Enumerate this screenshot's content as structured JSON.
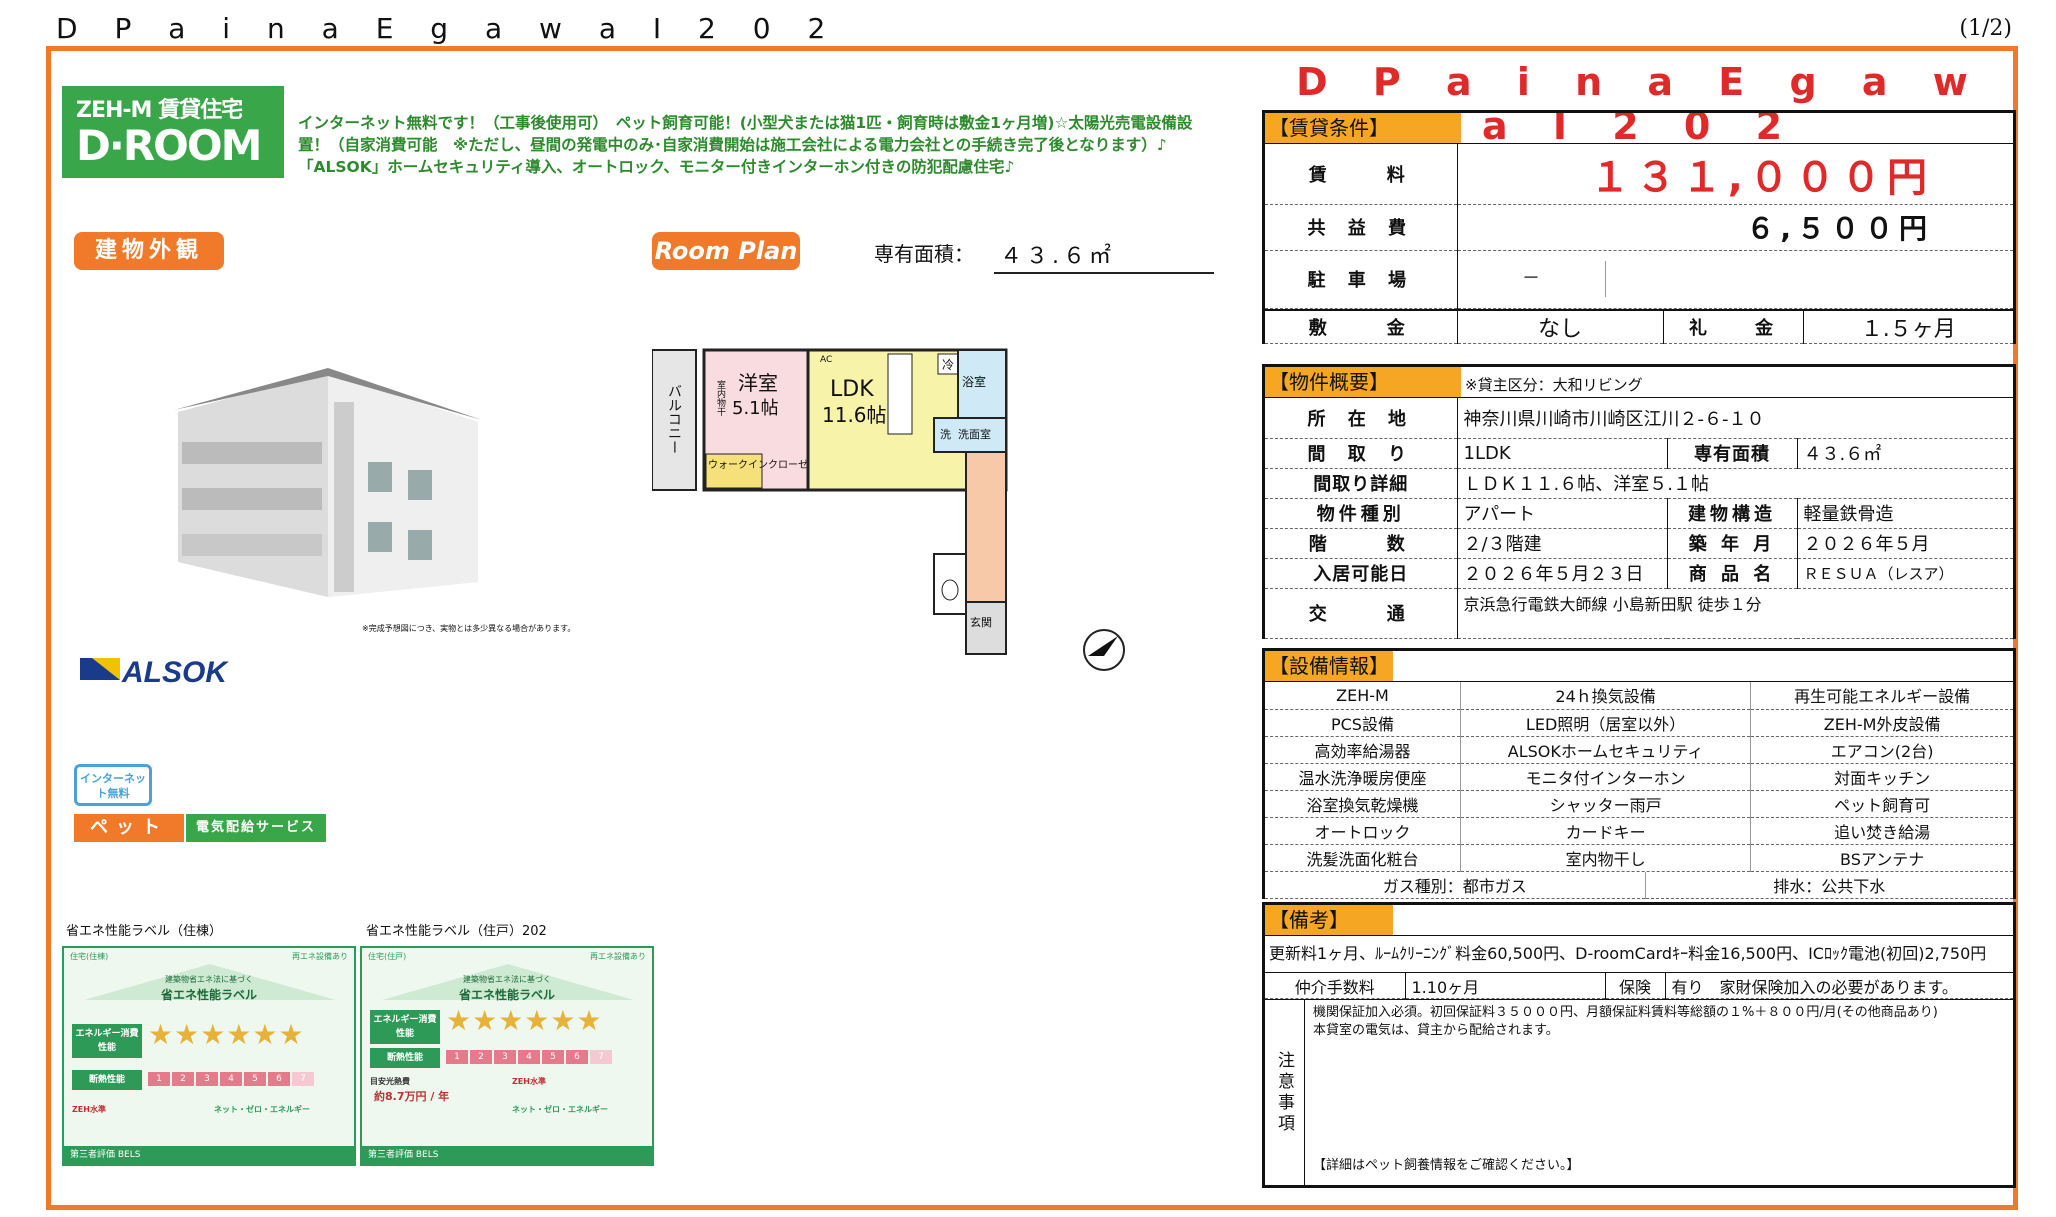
{
  "header": {
    "title": "D P a i n a  E g a w a  Ⅰ 2 0 2",
    "page": "(1/2)"
  },
  "logo": {
    "line1": "ZEH-M 賃貸住宅",
    "line2": "D·ROOM"
  },
  "intro": {
    "line1": "インターネット無料です！（工事後使用可）　ペット飼育可能！(小型犬または猫1匹・飼育時は敷金1ヶ月増)☆太陽光売電設備設",
    "line2": "置！（自家消費可能　※ただし、昼間の発電中のみ･自家消費開始は施工会社による電力会社との手続き完了後となります）♪",
    "line3": "「ALSOK」ホームセキュリティ導入、オートロック、モニター付きインターホン付きの防犯配慮住宅♪"
  },
  "tags": {
    "exterior": "建物外観",
    "plan": "Room Plan"
  },
  "area": {
    "label": "専有面積：",
    "value": "４３.６㎡"
  },
  "building_note": "※完成予想図につき、実物とは多少異なる場合があります。",
  "alsok": "ALSOK",
  "badges": {
    "net": "インターネット無料",
    "pet": "ペット",
    "elec": "電気配給サービス"
  },
  "plan": {
    "balcony": "バルコニー",
    "western_room": "洋室",
    "western_size": "5.1帖",
    "ldk": "LDK",
    "ldk_size": "11.6帖",
    "closet_in": "室内物干",
    "walkin": "ウォークインクローゼット",
    "bath": "浴室",
    "wash": "洗面室",
    "fridge": "冷",
    "entrance": "玄関",
    "ac": "AC",
    "wash_mark": "洗"
  },
  "labels": {
    "building_label_title": "省エネ性能ラベル（住棟）",
    "unit_label_title": "省エネ性能ラベル（住戸）202",
    "label_header_left_1": "住宅(住棟)",
    "label_header_left_2": "住宅(住戸)",
    "label_header_right": "再エネ設備あり",
    "label_sub": "建築物省エネ法に基づく",
    "label_name": "省エネ性能ラベル",
    "energy_row": "エネルギー消費性能",
    "insulation_row": "断熱性能",
    "zeh": "ZEH水準",
    "net_zero": "ネット・ゼロ・エネルギー",
    "cost_label": "目安光熱費",
    "cost_value": "約8.7万円 / 年",
    "footer": "第三者評価 BELS",
    "scale": [
      "1",
      "2",
      "3",
      "4",
      "5",
      "6",
      "7"
    ]
  },
  "property": {
    "title": "D P a i n a  E g a w a  Ⅰ 2 0 2"
  },
  "conditions": {
    "section": "【賃貸条件】",
    "rent_label": "賃　　料",
    "rent": "１３１,０００円",
    "common_label": "共 益 費",
    "common": "６,５００円",
    "parking_label": "駐 車 場",
    "parking": "－",
    "deposit_label": "敷　　金",
    "deposit": "なし",
    "key_label": "礼　　金",
    "key_money": "１.５ヶ月"
  },
  "overview": {
    "section": "【物件概要】",
    "note": "※貸主区分：大和リビング",
    "address_label": "所 在 地",
    "address": "神奈川県川崎市川崎区江川２-６-１０",
    "layout_label": "間 取 り",
    "layout": "1LDK",
    "area_label": "専有面積",
    "area": "４３.６㎡",
    "layout_detail_label": "間取り詳細",
    "layout_detail": "ＬＤＫ１１.６帖、洋室５.１帖",
    "type_label": "物件種別",
    "type": "アパート",
    "structure_label": "建物構造",
    "structure": "軽量鉄骨造",
    "floor_label": "階　　数",
    "floor": "２/３階建",
    "built_label": "築 年 月",
    "built": "２０２６年５月",
    "move_label": "入居可能日",
    "move": "２０２６年５月２３日",
    "product_label": "商 品 名",
    "product": "ＲＥＳＵＡ（レスア）",
    "access_label": "交　　通",
    "access": "京浜急行電鉄大師線 小島新田駅 徒歩１分"
  },
  "equipment": {
    "section": "【設備情報】",
    "rows": [
      [
        "ZEH-M",
        "24ｈ換気設備",
        "再生可能エネルギー設備"
      ],
      [
        "PCS設備",
        "LED照明（居室以外）",
        "ZEH-M外皮設備"
      ],
      [
        "高効率給湯器",
        "ALSOKホームセキュリティ",
        "エアコン(2台)"
      ],
      [
        "温水洗浄暖房便座",
        "モニタ付インターホン",
        "対面キッチン"
      ],
      [
        "浴室換気乾燥機",
        "シャッター雨戸",
        "ペット飼育可"
      ],
      [
        "オートロック",
        "カードキー",
        "追い焚き給湯"
      ],
      [
        "洗髪洗面化粧台",
        "室内物干し",
        "BSアンテナ"
      ]
    ],
    "gas": "ガス種別：都市ガス",
    "drain": "排水：公共下水"
  },
  "remarks": {
    "section": "【備考】",
    "text": "更新料1ヶ月、ﾙｰﾑｸﾘｰﾆﾝｸﾞ料金60,500円、D-roomCardｷｰ料金16,500円、ICﾛｯｸ電池(初回)2,750円",
    "brokerage_label": "仲介手数料",
    "brokerage": "1.10ヶ月",
    "insurance_label": "保険",
    "insurance": "有り　家財保険加入の必要があります。",
    "caution_label": "注意事項",
    "caution1": "機関保証加入必須。初回保証料３５０００円、月額保証料賃料等総額の１%＋８００円/月(その他商品あり)",
    "caution2": "本貸室の電気は、貸主から配給されます。",
    "caution3": "【詳細はペット飼養情報をご確認ください。】"
  }
}
